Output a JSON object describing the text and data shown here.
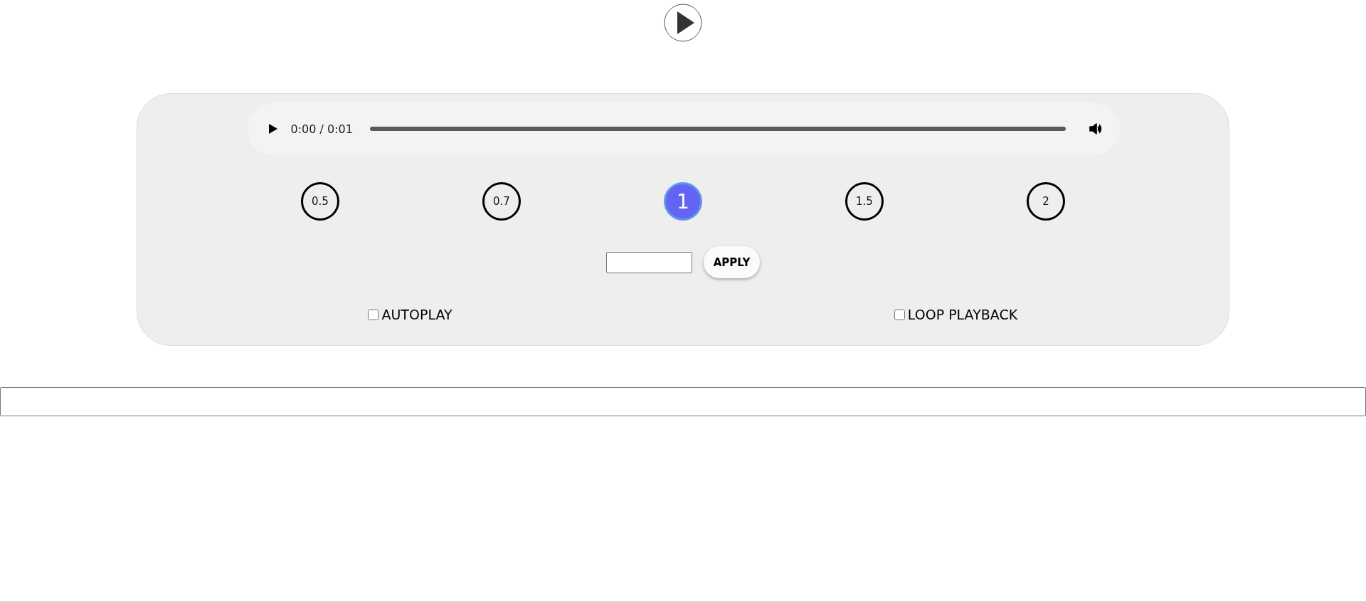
{
  "player": {
    "time": "0:00 / 0:01"
  },
  "speeds": [
    {
      "label": "0.5",
      "selected": false
    },
    {
      "label": "0.7",
      "selected": false
    },
    {
      "label": "1",
      "selected": true
    },
    {
      "label": "1.5",
      "selected": false
    },
    {
      "label": "2",
      "selected": false
    }
  ],
  "custom_speed": {
    "button": "APPLY"
  },
  "options": [
    {
      "label": "AUTOPLAY",
      "checked": false
    },
    {
      "label": "LOOP PLAYBACK",
      "checked": false
    }
  ]
}
